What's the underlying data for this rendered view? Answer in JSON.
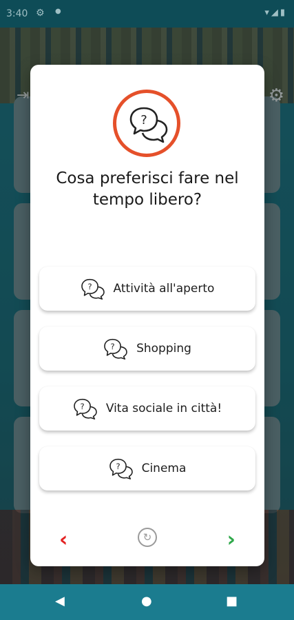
{
  "status_bar": {
    "time": "3:40",
    "icons": [
      "settings-icon",
      "notification-dot",
      "wifi-icon",
      "signal-icon",
      "battery-icon"
    ]
  },
  "dialog": {
    "question": "Cosa preferisci fare nel tempo libero?",
    "options": [
      {
        "label": "Attività all'aperto"
      },
      {
        "label": "Shopping"
      },
      {
        "label": "Vita sociale in città!"
      },
      {
        "label": "Cinema"
      }
    ],
    "footer": {
      "prev_glyph": "‹",
      "next_glyph": "›",
      "refresh_glyph": "↻"
    }
  },
  "colors": {
    "accent_ring": "#e5502a",
    "prev": "#e32222",
    "next": "#2fa84a",
    "nav_bar": "#1b7c8f"
  }
}
